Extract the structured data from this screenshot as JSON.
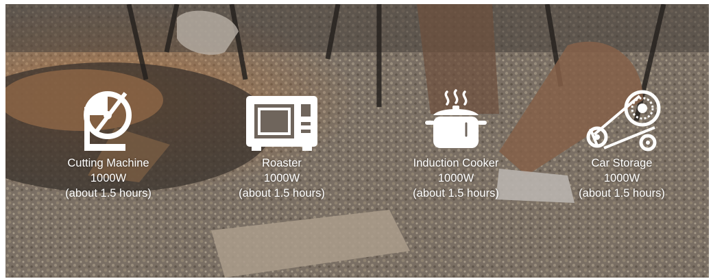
{
  "features": [
    {
      "icon": "cutting-machine-icon",
      "name": "Cutting Machine",
      "power": "1000W",
      "duration": "(about 1.5 hours)"
    },
    {
      "icon": "roaster-icon",
      "name": "Roaster",
      "power": "1000W",
      "duration": "(about 1.5 hours)"
    },
    {
      "icon": "induction-cooker-icon",
      "name": "Induction Cooker",
      "power": "1000W",
      "duration": "(about 1.5 hours)"
    },
    {
      "icon": "car-storage-icon",
      "name": "Car Storage",
      "power": "1000W",
      "duration": "(about 1.5 hours)"
    }
  ],
  "colors": {
    "text": "#ffffff",
    "icon": "#ffffff",
    "background_tone": "#6f655c"
  }
}
